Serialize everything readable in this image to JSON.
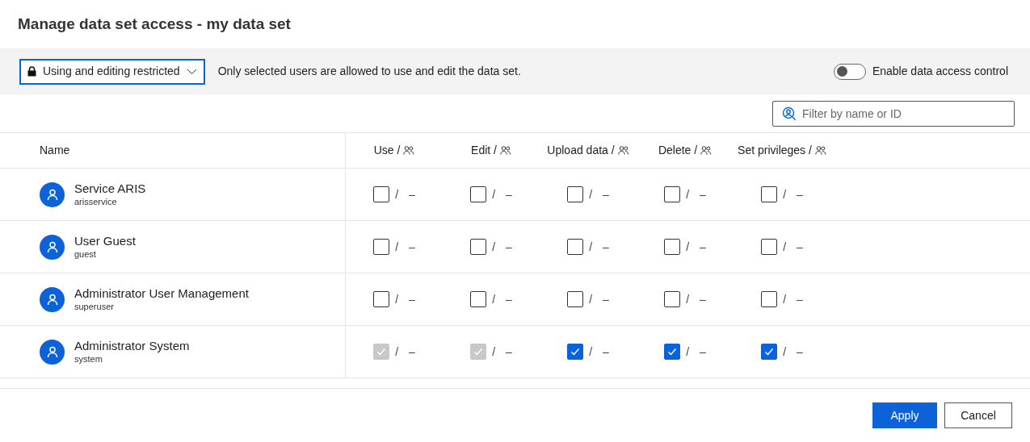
{
  "title": "Manage data set access - my data set",
  "access_mode": {
    "label": "Using and editing restricted",
    "description": "Only selected users are allowed to use and edit the data set."
  },
  "toggle": {
    "label": "Enable data access control",
    "on": false
  },
  "filter": {
    "placeholder": "Filter by name or ID"
  },
  "columns": [
    "Name",
    "Use /",
    "Edit /",
    "Upload data /",
    "Delete /",
    "Set privileges /"
  ],
  "rows": [
    {
      "name": "Service ARIS",
      "id": "arisservice",
      "cells": [
        {
          "checked": false,
          "disabled": false,
          "separator": "/",
          "group": "–"
        },
        {
          "checked": false,
          "disabled": false,
          "separator": "/",
          "group": "–"
        },
        {
          "checked": false,
          "disabled": false,
          "separator": "/",
          "group": "–"
        },
        {
          "checked": false,
          "disabled": false,
          "separator": "/",
          "group": "–"
        },
        {
          "checked": false,
          "disabled": false,
          "separator": "/",
          "group": "–"
        }
      ]
    },
    {
      "name": "User Guest",
      "id": "guest",
      "cells": [
        {
          "checked": false,
          "disabled": false,
          "separator": "/",
          "group": "–"
        },
        {
          "checked": false,
          "disabled": false,
          "separator": "/",
          "group": "–"
        },
        {
          "checked": false,
          "disabled": false,
          "separator": "/",
          "group": "–"
        },
        {
          "checked": false,
          "disabled": false,
          "separator": "/",
          "group": "–"
        },
        {
          "checked": false,
          "disabled": false,
          "separator": "/",
          "group": "–"
        }
      ]
    },
    {
      "name": "Administrator User Management",
      "id": "superuser",
      "cells": [
        {
          "checked": false,
          "disabled": false,
          "separator": "/",
          "group": "–"
        },
        {
          "checked": false,
          "disabled": false,
          "separator": "/",
          "group": "–"
        },
        {
          "checked": false,
          "disabled": false,
          "separator": "/",
          "group": "–"
        },
        {
          "checked": false,
          "disabled": false,
          "separator": "/",
          "group": "–"
        },
        {
          "checked": false,
          "disabled": false,
          "separator": "/",
          "group": "–"
        }
      ]
    },
    {
      "name": "Administrator System",
      "id": "system",
      "cells": [
        {
          "checked": true,
          "disabled": true,
          "separator": "/",
          "group": "–"
        },
        {
          "checked": true,
          "disabled": true,
          "separator": "/",
          "group": "–"
        },
        {
          "checked": true,
          "disabled": false,
          "separator": "/",
          "group": "–"
        },
        {
          "checked": true,
          "disabled": false,
          "separator": "/",
          "group": "–"
        },
        {
          "checked": true,
          "disabled": false,
          "separator": "/",
          "group": "–"
        }
      ]
    }
  ],
  "buttons": [
    {
      "label": "Apply",
      "kind": "primary"
    },
    {
      "label": "Cancel",
      "kind": "secondary"
    }
  ]
}
